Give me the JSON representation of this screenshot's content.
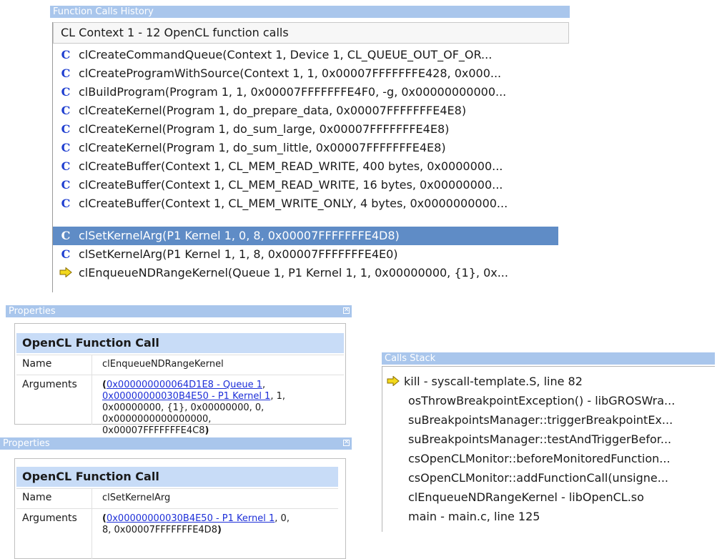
{
  "function_calls_history": {
    "title": "Function Calls History",
    "context_header": "CL Context 1 - 12 OpenCL function calls",
    "calls": [
      {
        "icon": "c-function-icon",
        "text": "clCreateCommandQueue(Context 1, Device 1, CL_QUEUE_OUT_OF_OR..."
      },
      {
        "icon": "c-function-icon",
        "text": "clCreateProgramWithSource(Context 1, 1, 0x00007FFFFFFFE428, 0x000..."
      },
      {
        "icon": "c-function-icon",
        "text": "clBuildProgram(Program 1, 1, 0x00007FFFFFFFE4F0, -g, 0x00000000000..."
      },
      {
        "icon": "c-function-icon",
        "text": "clCreateKernel(Program 1, do_prepare_data, 0x00007FFFFFFFE4E8)"
      },
      {
        "icon": "c-function-icon",
        "text": "clCreateKernel(Program 1, do_sum_large, 0x00007FFFFFFFE4E8)"
      },
      {
        "icon": "c-function-icon",
        "text": "clCreateKernel(Program 1, do_sum_little, 0x00007FFFFFFFE4E8)"
      },
      {
        "icon": "c-function-icon",
        "text": "clCreateBuffer(Context 1, CL_MEM_READ_WRITE, 400 bytes, 0x0000000..."
      },
      {
        "icon": "c-function-icon",
        "text": "clCreateBuffer(Context 1, CL_MEM_READ_WRITE, 16 bytes, 0x00000000..."
      },
      {
        "icon": "c-function-icon",
        "text": "clCreateBuffer(Context 1, CL_MEM_WRITE_ONLY, 4 bytes, 0x0000000000..."
      },
      {
        "icon": "c-function-icon",
        "text": "clSetKernelArg(P1 Kernel 1, 0, 8, 0x00007FFFFFFFE4D8)",
        "selected": true
      },
      {
        "icon": "c-function-icon",
        "text": "clSetKernelArg(P1 Kernel 1, 1, 8, 0x00007FFFFFFFE4E0)"
      },
      {
        "icon": "yellow-arrow-icon",
        "text": "clEnqueueNDRangeKernel(Queue 1, P1 Kernel 1, 1, 0x00000000, {1}, 0x..."
      }
    ]
  },
  "properties_1": {
    "title": "Properties",
    "close_glyph": "✕",
    "section_title": "OpenCL Function Call",
    "name_label": "Name",
    "name_value": "clEnqueueNDRangeKernel",
    "arguments_label": "Arguments",
    "open_paren": "(",
    "link_1": "0x000000000064D1E8 - Queue 1",
    "sep_1": ",",
    "link_2": "0x00000000030B4E50 - P1 Kernel 1",
    "args_rest_1": ", 1,",
    "args_rest_2": "0x00000000, {1}, 0x00000000, 0,",
    "args_rest_3": "0x0000000000000000,",
    "args_rest_4": "0x00007FFFFFFFE4C8",
    "close_paren": ")"
  },
  "properties_2": {
    "title": "Properties",
    "close_glyph": "✕",
    "section_title": "OpenCL Function Call",
    "name_label": "Name",
    "name_value": "clSetKernelArg",
    "arguments_label": "Arguments",
    "open_paren": "(",
    "link_1": "0x00000000030B4E50 - P1 Kernel 1",
    "args_rest_1": ", 0,",
    "args_rest_2": "8, 0x00007FFFFFFFE4D8",
    "close_paren": ")"
  },
  "calls_stack": {
    "title": "Calls Stack",
    "frames": [
      {
        "icon": "yellow-arrow-icon",
        "text": "kill - syscall-template.S, line 82"
      },
      {
        "text": "osThrowBreakpointException() - libGROSWra..."
      },
      {
        "text": "suBreakpointsManager::triggerBreakpointEx..."
      },
      {
        "text": "suBreakpointsManager::testAndTriggerBefor..."
      },
      {
        "text": "csOpenCLMonitor::beforeMonitoredFunction..."
      },
      {
        "text": "csOpenCLMonitor::addFunctionCall(unsigne..."
      },
      {
        "text": "clEnqueueNDRangeKernel - libOpenCL.so"
      },
      {
        "text": "main - main.c, line 125"
      }
    ]
  },
  "colors": {
    "panel_title_bg": "#a9c6ec",
    "selection_bg": "#5f8cc6",
    "section_bg": "#c8dcf7",
    "link": "#1d2fd8",
    "arrow": "#f2d81c"
  }
}
